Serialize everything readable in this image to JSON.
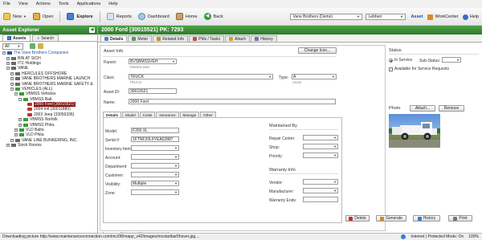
{
  "menubar": {
    "file": "File",
    "view": "View",
    "actions": "Actions",
    "tools": "Tools",
    "applications": "Applications",
    "help": "Help"
  },
  "toolbar": {
    "new": "New",
    "open": "Open",
    "explore": "Explore",
    "reports": "Reports",
    "dashboard": "Dashboard",
    "home": "Home",
    "back": "Back",
    "company": "Vane Brothers (Demo)",
    "user": "Lebherr",
    "asset": "Asset",
    "workcenter": "WorkCenter",
    "help": "Help"
  },
  "explorer": {
    "title": "Asset Explorer",
    "tab_assets": "Assets",
    "tab_search": "Search",
    "filter": "All",
    "tree": [
      {
        "label": "The Vane Brothers Companies",
        "indent": 0,
        "kind": "root"
      },
      {
        "label": "BIN AT SICH",
        "indent": 1,
        "kind": "loc"
      },
      {
        "label": "ITC Holdings",
        "indent": 1,
        "kind": "loc"
      },
      {
        "label": "VANE",
        "indent": 1,
        "kind": "loc"
      },
      {
        "label": "HERCULES OFFSHORE",
        "indent": 2,
        "kind": "loc"
      },
      {
        "label": "VANE BROTHERS MARINE LAUNCH",
        "indent": 2,
        "kind": "loc"
      },
      {
        "label": "VANE BROTHERS MARINE SAFETY &",
        "indent": 2,
        "kind": "loc"
      },
      {
        "label": "VEHICLES (ALL)",
        "indent": 2,
        "kind": "veh"
      },
      {
        "label": "VBMSS Vehicles",
        "indent": 3,
        "kind": "veh"
      },
      {
        "label": "VBMSS Balt.",
        "indent": 4,
        "kind": "veh"
      },
      {
        "label": "2000 Ford (30015521)",
        "indent": 5,
        "kind": "car",
        "selected": true
      },
      {
        "label": "2004 Intl (30011880)",
        "indent": 5,
        "kind": "car"
      },
      {
        "label": "2003 Jeep (33056336)",
        "indent": 5,
        "kind": "car"
      },
      {
        "label": "VBMSS Norfolk",
        "indent": 4,
        "kind": "veh"
      },
      {
        "label": "VBMSS Phila.",
        "indent": 4,
        "kind": "veh"
      },
      {
        "label": "VLD Balto.",
        "indent": 3,
        "kind": "veh"
      },
      {
        "label": "VLD Phila.",
        "indent": 3,
        "kind": "veh"
      },
      {
        "label": "VANE LINE BUNKERING, INC.",
        "indent": 2,
        "kind": "loc"
      },
      {
        "label": "Stock Rooms",
        "indent": 1,
        "kind": "loc"
      }
    ]
  },
  "record": {
    "title": "2000 Ford  (30015521)  PK: 7293",
    "tabs": [
      "Details",
      "Meter",
      "Related Info",
      "PMs / Tasks",
      "Attach",
      "History"
    ],
    "asset_info_title": "Asset Info",
    "change_icon": "Change Icon...",
    "parent_label": "Parent:",
    "parent_value": "BVSBMSSVEH",
    "parent_sub": "VBMSS Balt.",
    "class_label": "Class:",
    "class_value": "TRUCK",
    "class_sub": "TRUCK",
    "type_label": "Type:",
    "type_value": "A",
    "type_sub": "Asset",
    "asset_id_label": "Asset ID:",
    "asset_id_value": "30015521",
    "name_label": "Name:",
    "name_value": "2000 Ford",
    "inner_tabs": [
      "Details",
      "Model",
      "Costs",
      "Insurance",
      "Manage",
      "Other"
    ],
    "model_label": "Model:",
    "model_value": "F350 XL",
    "serial_label": "Serial #:",
    "serial_value": "1FTNF20L6YEA02887",
    "inventory_label": "Inventory Item:",
    "account_label": "Account:",
    "department_label": "Department:",
    "customer_label": "Customer:",
    "visibility_label": "Visibility:",
    "visibility_value": "Multiple",
    "zone_label": "Zone:",
    "maintained_title": "Maintained By",
    "repair_label": "Repair Center:",
    "shop_label": "Shop:",
    "priority_label": "Priority:",
    "warranty_title": "Warranty Info",
    "vendor_label": "Vendor:",
    "manufacturer_label": "Manufacturer:",
    "warranty_ends_label": "Warranty Ends:",
    "status_title": "Status",
    "in_service": "In Service",
    "sub_status": "Sub-Status:",
    "available": "Available for Service Requests",
    "photo_title": "Photo",
    "attach_btn": "Attach...",
    "remove_btn": "Remove",
    "pages": [
      "Page 1",
      "Page 2",
      "User-Defined"
    ],
    "delete_btn": "Delete",
    "generate_btn": "Generate",
    "history_btn": "History",
    "print_btn": "Print"
  },
  "statusbar": {
    "text": "Downloading picture http://www.maintenanceconnection.com/mc/08/mapp_v42/images/mcstartbar5hover.jpg....",
    "zone": "Internet | Protected Mode: On",
    "zoom": "100%"
  }
}
